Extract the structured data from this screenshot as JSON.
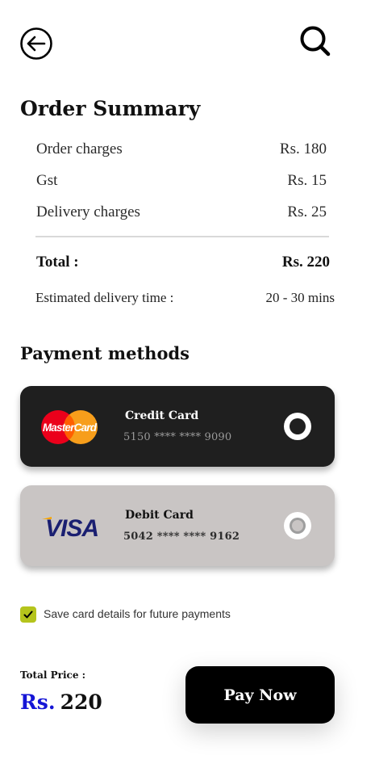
{
  "header": {
    "back_icon": "arrow-left-circle-icon",
    "search_icon": "search-icon"
  },
  "order_summary": {
    "title": "Order Summary",
    "rows": [
      {
        "label": "Order charges",
        "value": "Rs. 180"
      },
      {
        "label": "Gst",
        "value": "Rs. 15"
      },
      {
        "label": "Delivery charges",
        "value": "Rs. 25"
      }
    ],
    "total": {
      "label": "Total :",
      "value": "Rs. 220"
    },
    "eta": {
      "label": "Estimated delivery time :",
      "value": "20 - 30 mins"
    }
  },
  "payment": {
    "title": "Payment methods",
    "cards": [
      {
        "name": "Credit Card",
        "number": "5150 **** **** 9090",
        "brand": "MasterCard",
        "selected": true
      },
      {
        "name": "Debit Card",
        "number": "5042 **** **** 9162",
        "brand": "VISA",
        "selected": false
      }
    ],
    "save_card": {
      "label": "Save card details for future payments",
      "checked": true
    }
  },
  "footer": {
    "total_label": "Total Price :",
    "currency": "Rs.",
    "amount": "220",
    "pay_button": "Pay Now"
  },
  "colors": {
    "accent_blue": "#1515d6",
    "checkbox_green": "#b5c41c",
    "credit_card_bg": "#1f1f1f",
    "debit_card_bg": "#c9c5c4"
  }
}
